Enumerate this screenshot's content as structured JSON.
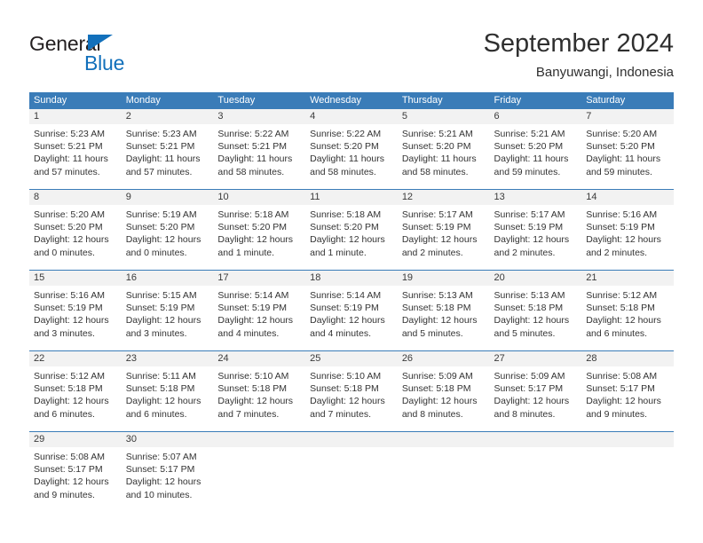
{
  "brand": {
    "name_part1": "General",
    "name_part2": "Blue",
    "triangle_icon": "triangle-icon",
    "color_dark": "#231f20",
    "color_blue": "#1270bb"
  },
  "header": {
    "title": "September 2024",
    "subtitle": "Banyuwangi, Indonesia"
  },
  "calendar": {
    "accent_color": "#3a7cb8",
    "band_color": "#f2f2f2",
    "weekday_headers": [
      "Sunday",
      "Monday",
      "Tuesday",
      "Wednesday",
      "Thursday",
      "Friday",
      "Saturday"
    ],
    "weeks": [
      [
        {
          "day": "1",
          "sunrise": "Sunrise: 5:23 AM",
          "sunset": "Sunset: 5:21 PM",
          "daylight1": "Daylight: 11 hours",
          "daylight2": "and 57 minutes."
        },
        {
          "day": "2",
          "sunrise": "Sunrise: 5:23 AM",
          "sunset": "Sunset: 5:21 PM",
          "daylight1": "Daylight: 11 hours",
          "daylight2": "and 57 minutes."
        },
        {
          "day": "3",
          "sunrise": "Sunrise: 5:22 AM",
          "sunset": "Sunset: 5:21 PM",
          "daylight1": "Daylight: 11 hours",
          "daylight2": "and 58 minutes."
        },
        {
          "day": "4",
          "sunrise": "Sunrise: 5:22 AM",
          "sunset": "Sunset: 5:20 PM",
          "daylight1": "Daylight: 11 hours",
          "daylight2": "and 58 minutes."
        },
        {
          "day": "5",
          "sunrise": "Sunrise: 5:21 AM",
          "sunset": "Sunset: 5:20 PM",
          "daylight1": "Daylight: 11 hours",
          "daylight2": "and 58 minutes."
        },
        {
          "day": "6",
          "sunrise": "Sunrise: 5:21 AM",
          "sunset": "Sunset: 5:20 PM",
          "daylight1": "Daylight: 11 hours",
          "daylight2": "and 59 minutes."
        },
        {
          "day": "7",
          "sunrise": "Sunrise: 5:20 AM",
          "sunset": "Sunset: 5:20 PM",
          "daylight1": "Daylight: 11 hours",
          "daylight2": "and 59 minutes."
        }
      ],
      [
        {
          "day": "8",
          "sunrise": "Sunrise: 5:20 AM",
          "sunset": "Sunset: 5:20 PM",
          "daylight1": "Daylight: 12 hours",
          "daylight2": "and 0 minutes."
        },
        {
          "day": "9",
          "sunrise": "Sunrise: 5:19 AM",
          "sunset": "Sunset: 5:20 PM",
          "daylight1": "Daylight: 12 hours",
          "daylight2": "and 0 minutes."
        },
        {
          "day": "10",
          "sunrise": "Sunrise: 5:18 AM",
          "sunset": "Sunset: 5:20 PM",
          "daylight1": "Daylight: 12 hours",
          "daylight2": "and 1 minute."
        },
        {
          "day": "11",
          "sunrise": "Sunrise: 5:18 AM",
          "sunset": "Sunset: 5:20 PM",
          "daylight1": "Daylight: 12 hours",
          "daylight2": "and 1 minute."
        },
        {
          "day": "12",
          "sunrise": "Sunrise: 5:17 AM",
          "sunset": "Sunset: 5:19 PM",
          "daylight1": "Daylight: 12 hours",
          "daylight2": "and 2 minutes."
        },
        {
          "day": "13",
          "sunrise": "Sunrise: 5:17 AM",
          "sunset": "Sunset: 5:19 PM",
          "daylight1": "Daylight: 12 hours",
          "daylight2": "and 2 minutes."
        },
        {
          "day": "14",
          "sunrise": "Sunrise: 5:16 AM",
          "sunset": "Sunset: 5:19 PM",
          "daylight1": "Daylight: 12 hours",
          "daylight2": "and 2 minutes."
        }
      ],
      [
        {
          "day": "15",
          "sunrise": "Sunrise: 5:16 AM",
          "sunset": "Sunset: 5:19 PM",
          "daylight1": "Daylight: 12 hours",
          "daylight2": "and 3 minutes."
        },
        {
          "day": "16",
          "sunrise": "Sunrise: 5:15 AM",
          "sunset": "Sunset: 5:19 PM",
          "daylight1": "Daylight: 12 hours",
          "daylight2": "and 3 minutes."
        },
        {
          "day": "17",
          "sunrise": "Sunrise: 5:14 AM",
          "sunset": "Sunset: 5:19 PM",
          "daylight1": "Daylight: 12 hours",
          "daylight2": "and 4 minutes."
        },
        {
          "day": "18",
          "sunrise": "Sunrise: 5:14 AM",
          "sunset": "Sunset: 5:19 PM",
          "daylight1": "Daylight: 12 hours",
          "daylight2": "and 4 minutes."
        },
        {
          "day": "19",
          "sunrise": "Sunrise: 5:13 AM",
          "sunset": "Sunset: 5:18 PM",
          "daylight1": "Daylight: 12 hours",
          "daylight2": "and 5 minutes."
        },
        {
          "day": "20",
          "sunrise": "Sunrise: 5:13 AM",
          "sunset": "Sunset: 5:18 PM",
          "daylight1": "Daylight: 12 hours",
          "daylight2": "and 5 minutes."
        },
        {
          "day": "21",
          "sunrise": "Sunrise: 5:12 AM",
          "sunset": "Sunset: 5:18 PM",
          "daylight1": "Daylight: 12 hours",
          "daylight2": "and 6 minutes."
        }
      ],
      [
        {
          "day": "22",
          "sunrise": "Sunrise: 5:12 AM",
          "sunset": "Sunset: 5:18 PM",
          "daylight1": "Daylight: 12 hours",
          "daylight2": "and 6 minutes."
        },
        {
          "day": "23",
          "sunrise": "Sunrise: 5:11 AM",
          "sunset": "Sunset: 5:18 PM",
          "daylight1": "Daylight: 12 hours",
          "daylight2": "and 6 minutes."
        },
        {
          "day": "24",
          "sunrise": "Sunrise: 5:10 AM",
          "sunset": "Sunset: 5:18 PM",
          "daylight1": "Daylight: 12 hours",
          "daylight2": "and 7 minutes."
        },
        {
          "day": "25",
          "sunrise": "Sunrise: 5:10 AM",
          "sunset": "Sunset: 5:18 PM",
          "daylight1": "Daylight: 12 hours",
          "daylight2": "and 7 minutes."
        },
        {
          "day": "26",
          "sunrise": "Sunrise: 5:09 AM",
          "sunset": "Sunset: 5:18 PM",
          "daylight1": "Daylight: 12 hours",
          "daylight2": "and 8 minutes."
        },
        {
          "day": "27",
          "sunrise": "Sunrise: 5:09 AM",
          "sunset": "Sunset: 5:17 PM",
          "daylight1": "Daylight: 12 hours",
          "daylight2": "and 8 minutes."
        },
        {
          "day": "28",
          "sunrise": "Sunrise: 5:08 AM",
          "sunset": "Sunset: 5:17 PM",
          "daylight1": "Daylight: 12 hours",
          "daylight2": "and 9 minutes."
        }
      ],
      [
        {
          "day": "29",
          "sunrise": "Sunrise: 5:08 AM",
          "sunset": "Sunset: 5:17 PM",
          "daylight1": "Daylight: 12 hours",
          "daylight2": "and 9 minutes."
        },
        {
          "day": "30",
          "sunrise": "Sunrise: 5:07 AM",
          "sunset": "Sunset: 5:17 PM",
          "daylight1": "Daylight: 12 hours",
          "daylight2": "and 10 minutes."
        },
        {
          "day": "",
          "sunrise": "",
          "sunset": "",
          "daylight1": "",
          "daylight2": ""
        },
        {
          "day": "",
          "sunrise": "",
          "sunset": "",
          "daylight1": "",
          "daylight2": ""
        },
        {
          "day": "",
          "sunrise": "",
          "sunset": "",
          "daylight1": "",
          "daylight2": ""
        },
        {
          "day": "",
          "sunrise": "",
          "sunset": "",
          "daylight1": "",
          "daylight2": ""
        },
        {
          "day": "",
          "sunrise": "",
          "sunset": "",
          "daylight1": "",
          "daylight2": ""
        }
      ]
    ]
  }
}
